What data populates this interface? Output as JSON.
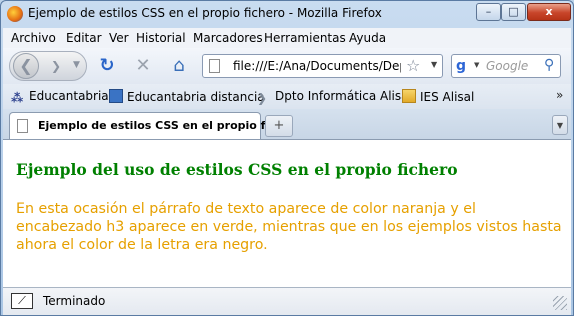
{
  "window": {
    "title": "Ejemplo de estilos CSS en el propio fichero - Mozilla Firefox",
    "controls": {
      "minimize": "–",
      "maximize": "□",
      "close": "x"
    }
  },
  "menu": {
    "items": [
      "Archivo",
      "Editar",
      "Ver",
      "Historial",
      "Marcadores",
      "Herramientas",
      "Ayuda"
    ]
  },
  "navigation": {
    "url": "file:///E:/Ana/Documents/Depa",
    "search_placeholder": "Google"
  },
  "bookmarks": {
    "items": [
      "Educantabria",
      "Educantabria distancia",
      "Dpto Informática Alisal",
      "IES Alisal"
    ],
    "overflow": "»"
  },
  "tabs": {
    "active_label": "Ejemplo de estilos CSS en el propio fi...",
    "new_tab": "+"
  },
  "content": {
    "heading": "Ejemplo del uso de estilos CSS en el propio fichero",
    "paragraph": "En esta ocasión el párrafo de texto aparece de color naranja y el encabezado h3 aparece en verde, mientras que en los ejemplos vistos hasta ahora el color de la letra era negro.",
    "heading_color": "#008000",
    "paragraph_color": "#e6a000"
  },
  "status": {
    "text": "Terminado"
  },
  "icons": [
    "firefox-icon",
    "back-icon",
    "forward-icon",
    "reload-icon",
    "stop-icon",
    "home-icon",
    "page-icon",
    "star-icon",
    "google-icon",
    "magnifier-icon",
    "bookmark-icon",
    "folder-icon"
  ]
}
